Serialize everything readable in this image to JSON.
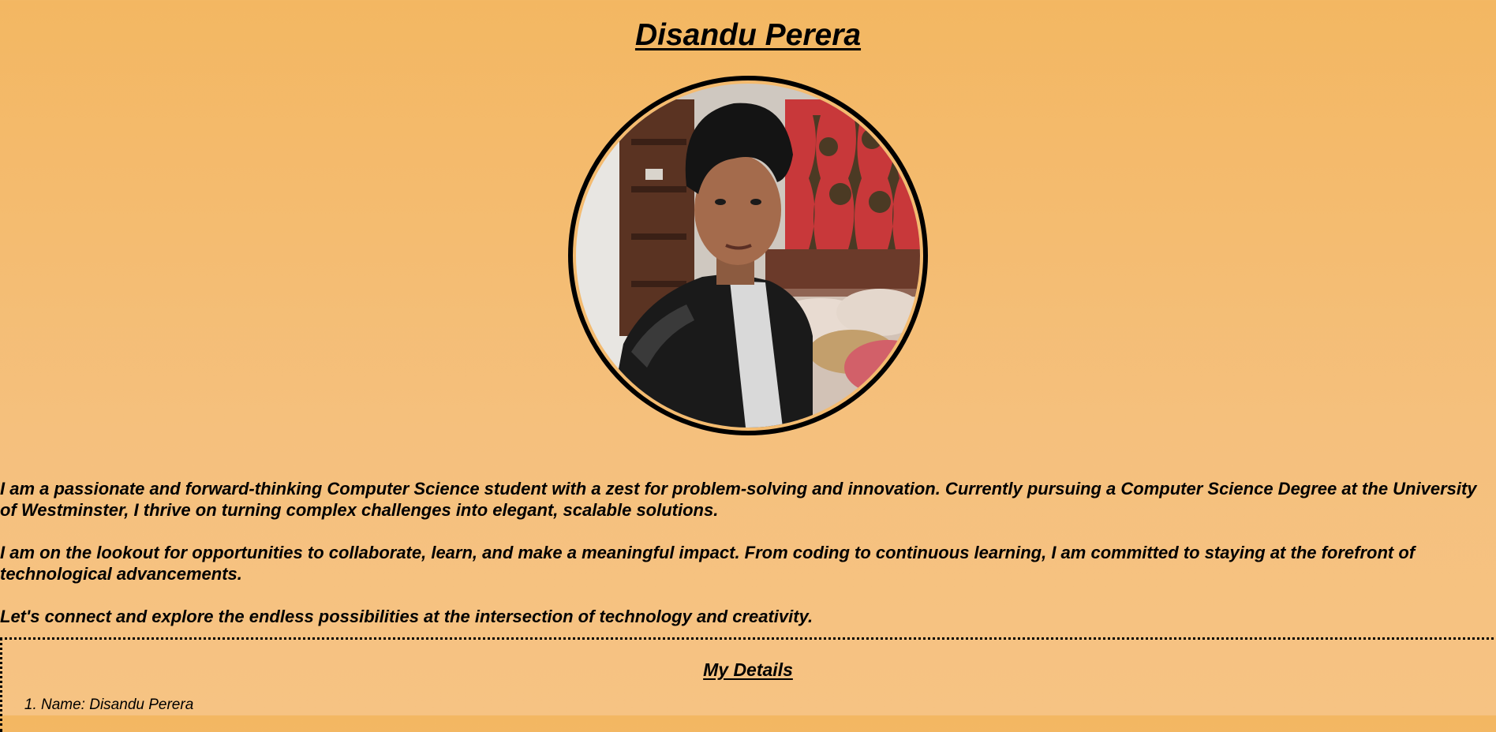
{
  "header": {
    "title": "Disandu Perera"
  },
  "profile": {
    "photo_alt": "Disandu Perera"
  },
  "bio": {
    "paragraphs": [
      "I am a passionate and forward-thinking Computer Science student with a zest for problem-solving and innovation. Currently pursuing a Computer Science Degree at the University of Westminster, I thrive on turning complex challenges into elegant, scalable solutions.",
      "I am on the lookout for opportunities to collaborate, learn, and make a meaningful impact. From coding to continuous learning, I am committed to staying at the forefront of technological advancements.",
      "Let's connect and explore the endless possibilities at the intersection of technology and creativity."
    ]
  },
  "details": {
    "title": "My Details",
    "items": [
      "Name: Disandu Perera"
    ]
  },
  "colors": {
    "background_top": "#f3b762",
    "background_bottom": "#f6c383",
    "text": "#000000"
  }
}
